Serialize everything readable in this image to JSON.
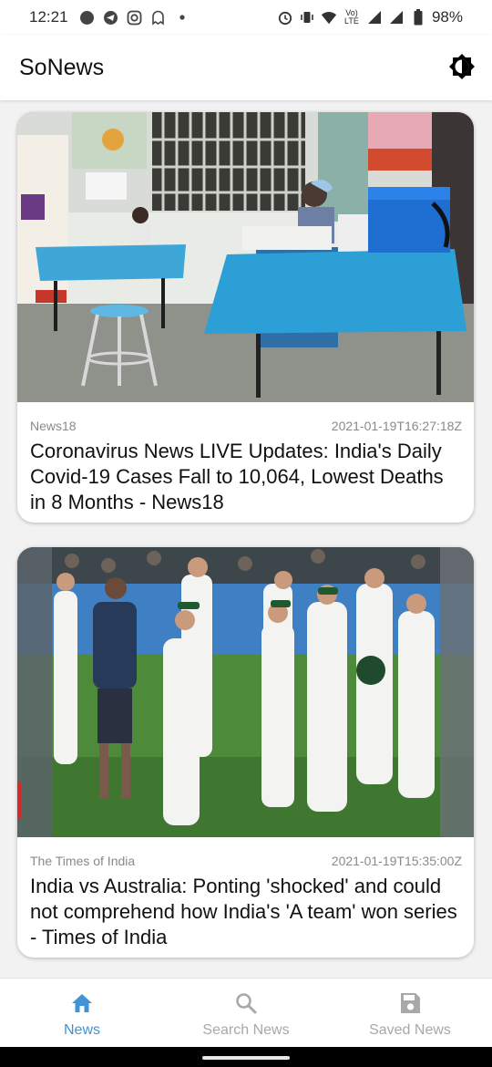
{
  "status_bar": {
    "time": "12:21",
    "battery": "98%",
    "network": "Vo) LTE"
  },
  "app": {
    "title": "SoNews",
    "theme_toggle_icon": "brightness-icon"
  },
  "articles": [
    {
      "source": "News18",
      "published": "2021-01-19T16:27:18Z",
      "title": "Coronavirus News LIVE Updates: India's Daily Covid-19 Cases Fall to 10,064, Lowest Deaths in 8 Months - News18"
    },
    {
      "source": "The Times of India",
      "published": "2021-01-19T15:35:00Z",
      "title": "India vs Australia: Ponting 'shocked' and could not comprehend how India's 'A team' won series - Times of India"
    }
  ],
  "bottom_nav": {
    "items": [
      {
        "label": "News",
        "icon": "home-icon",
        "active": true
      },
      {
        "label": "Search News",
        "icon": "search-icon",
        "active": false
      },
      {
        "label": "Saved News",
        "icon": "save-icon",
        "active": false
      }
    ]
  },
  "colors": {
    "accent": "#3f93d6",
    "inactive": "#a8a8a8",
    "background": "#f2f2f2"
  }
}
